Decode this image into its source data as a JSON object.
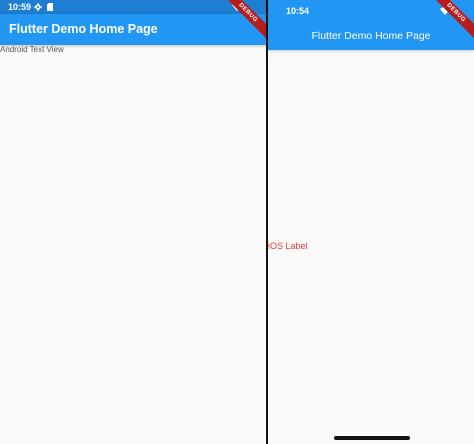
{
  "android": {
    "status_time": "10:59",
    "app_title": "Flutter Demo Home Page",
    "body_text": "Android Text View",
    "debug_banner": "DEBUG"
  },
  "ios": {
    "status_time": "10:54",
    "app_title": "Flutter Demo Home Page",
    "body_text": "iOS Label",
    "debug_banner": "DEBUG"
  },
  "colors": {
    "app_bar": "#2196f3",
    "status_bar": "#1e7ed1",
    "ios_label": "#e53935",
    "debug_ribbon": "#b71c1c"
  },
  "icons": [
    "gear-icon",
    "sim-card-icon",
    "wifi-icon"
  ]
}
